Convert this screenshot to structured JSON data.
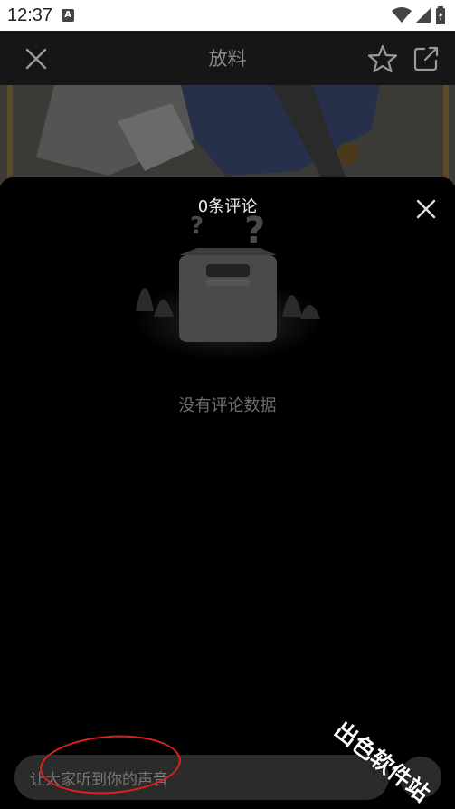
{
  "status_bar": {
    "time": "12:37",
    "notif_letter": "A"
  },
  "app_bar": {
    "title": "放料"
  },
  "comments": {
    "header": "0条评论",
    "empty_text": "没有评论数据",
    "input_placeholder": "让大家听到你的声音"
  },
  "watermark": "出色软件站",
  "colors": {
    "accent_annotation": "#e02020",
    "sheet_bg": "#000000",
    "appbar_bg": "#161616"
  }
}
